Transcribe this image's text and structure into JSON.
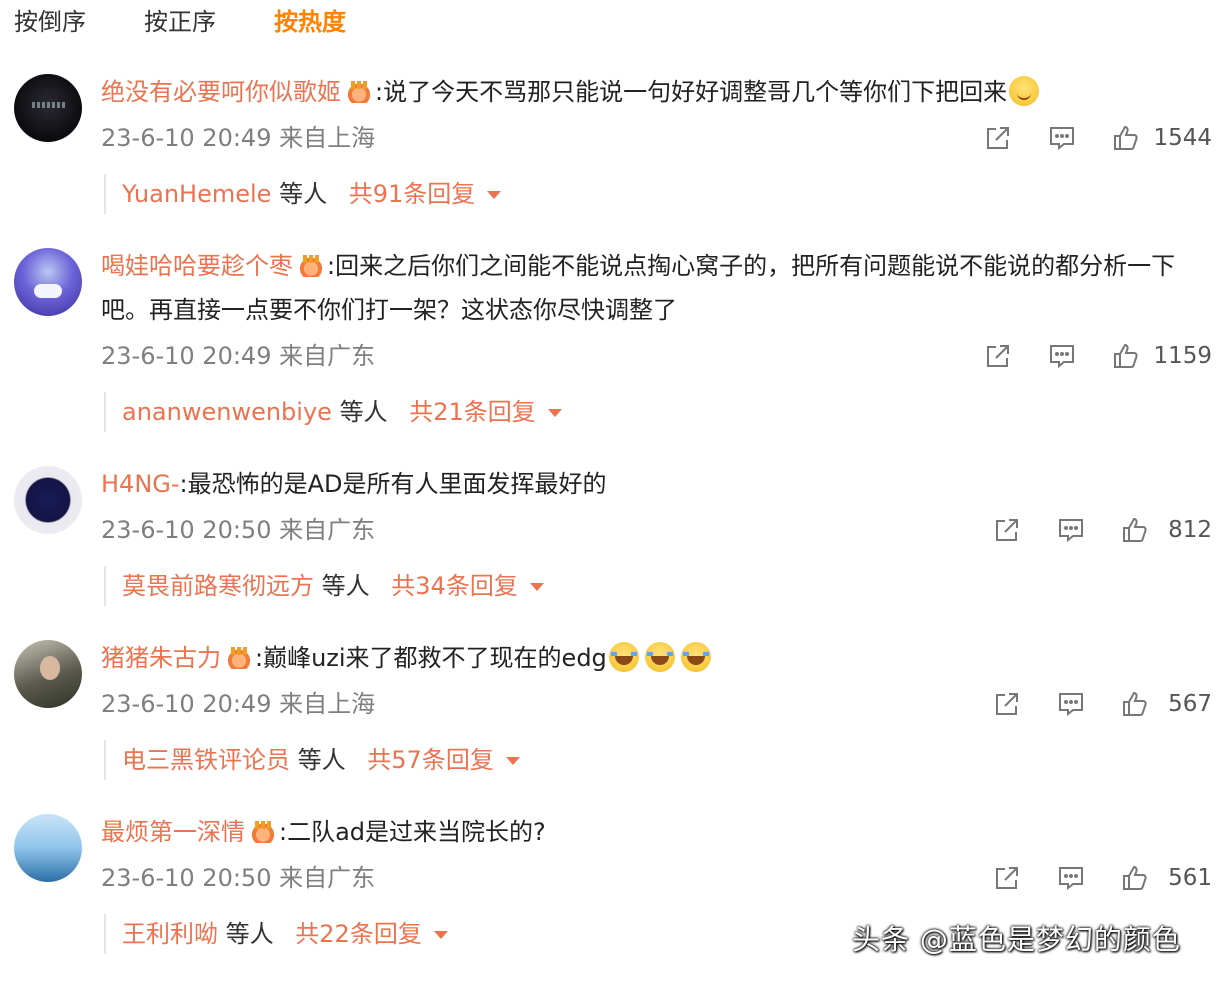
{
  "tabs": [
    "按倒序",
    "按正序",
    "按热度"
  ],
  "active_tab_index": 2,
  "comments": [
    {
      "username": "绝没有必要呵你似歌姬",
      "has_crown": true,
      "text": ":说了今天不骂那只能说一句好好调整哥几个等你们下把回来",
      "emoji": [
        "smile"
      ],
      "time": "23-6-10 20:49 来自上海",
      "likes": "1544",
      "reply_user": "YuanHemele",
      "reply_suffix": "等人",
      "reply_total": "共91条回复"
    },
    {
      "username": "喝娃哈哈要趁个枣",
      "has_crown": true,
      "text": ":回来之后你们之间能不能说点掏心窝子的，把所有问题能说不能说的都分析一下吧。再直接一点要不你们打一架？这状态你尽快调整了",
      "emoji": [],
      "time": "23-6-10 20:49 来自广东",
      "likes": "1159",
      "reply_user": "ananwenwenbiye",
      "reply_suffix": "等人",
      "reply_total": "共21条回复"
    },
    {
      "username": "H4NG-",
      "has_crown": false,
      "text": ":最恐怖的是AD是所有人里面发挥最好的",
      "emoji": [],
      "time": "23-6-10 20:50 来自广东",
      "likes": "812",
      "reply_user": "莫畏前路寒彻远方",
      "reply_suffix": "等人",
      "reply_total": "共34条回复"
    },
    {
      "username": "猪猪朱古力",
      "has_crown": true,
      "text": ":巅峰uzi来了都救不了现在的edg",
      "emoji": [
        "laugh",
        "laugh",
        "laugh"
      ],
      "time": "23-6-10 20:49 来自上海",
      "likes": "567",
      "reply_user": "电三黑铁评论员",
      "reply_suffix": "等人",
      "reply_total": "共57条回复"
    },
    {
      "username": "最烦第一深情",
      "has_crown": true,
      "text": ":二队ad是过来当院长的?",
      "emoji": [],
      "time": "23-6-10 20:50 来自广东",
      "likes": "561",
      "reply_user": "王利利呦",
      "reply_suffix": "等人",
      "reply_total": "共22条回复"
    }
  ],
  "icons": [
    "share-icon",
    "comment-icon",
    "like-icon"
  ],
  "watermark": "头条 @蓝色是梦幻的颜色",
  "colors": {
    "accent": "#ff8200",
    "username": "#eb7350",
    "meta": "#7f7f7f"
  }
}
